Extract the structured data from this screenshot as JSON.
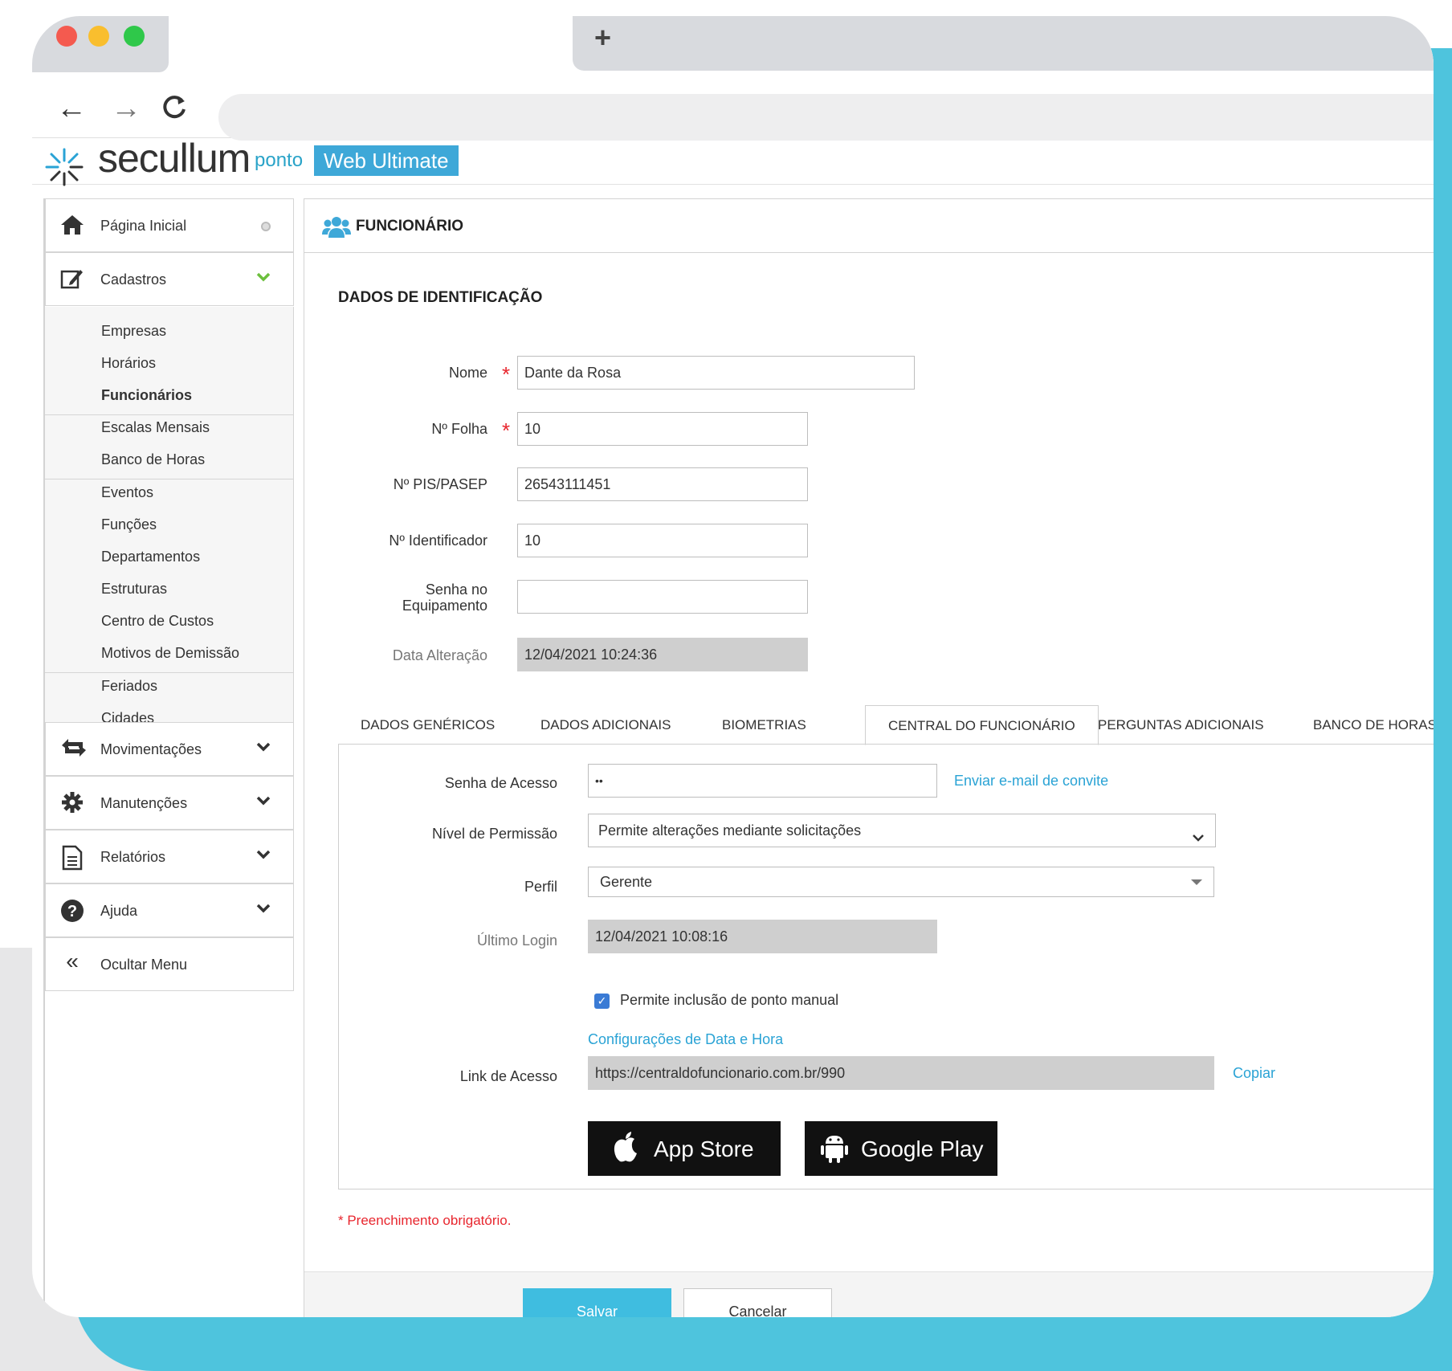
{
  "browser": {
    "new_tab_symbol": "+",
    "back_symbol": "←",
    "forward_symbol": "→",
    "reload_symbol": "C",
    "address": ""
  },
  "app": {
    "brand": "secullum",
    "product": "ponto",
    "edition": "Web Ultimate"
  },
  "sidebar": {
    "home": "Página Inicial",
    "cadastros": "Cadastros",
    "submenu": [
      "Empresas",
      "Horários",
      "Funcionários",
      "Escalas Mensais",
      "Banco de Horas",
      "Eventos",
      "Funções",
      "Departamentos",
      "Estruturas",
      "Centro de Custos",
      "Motivos de Demissão",
      "Feriados",
      "Cidades"
    ],
    "active_submenu": "Funcionários",
    "movimentacoes": "Movimentações",
    "manutencoes": "Manutenções",
    "relatorios": "Relatórios",
    "ajuda": "Ajuda",
    "ocultar": "Ocultar Menu",
    "chevron": "❯",
    "collapse_symbol": "«"
  },
  "panel": {
    "title": "FUNCIONÁRIO",
    "section_title": "DADOS DE IDENTIFICAÇÃO"
  },
  "fields": {
    "nome_label": "Nome",
    "nome_value": "Dante da Rosa",
    "folha_label": "Nº Folha",
    "folha_value": "10",
    "pis_label": "Nº PIS/PASEP",
    "pis_value": "26543111451",
    "identificador_label": "Nº Identificador",
    "identificador_value": "10",
    "senha_equip_label_1": "Senha no",
    "senha_equip_label_2": "Equipamento",
    "senha_equip_value": "",
    "data_alteracao_label": "Data Alteração",
    "data_alteracao_value": "12/04/2021 10:24:36",
    "required_mark": "*"
  },
  "tabs": [
    "DADOS GENÉRICOS",
    "DADOS ADICIONAIS",
    "BIOMETRIAS",
    "CENTRAL DO FUNCIONÁRIO",
    "PERGUNTAS ADICIONAIS",
    "BANCO DE HORAS"
  ],
  "active_tab": "CENTRAL DO FUNCIONÁRIO",
  "central": {
    "senha_label": "Senha de Acesso",
    "senha_value": "••",
    "invite_link": "Enviar e-mail de convite",
    "nivel_label": "Nível de Permissão",
    "nivel_value": "Permite alterações mediante solicitações",
    "perfil_label": "Perfil",
    "perfil_value": "Gerente",
    "ultimo_login_label": "Último Login",
    "ultimo_login_value": "12/04/2021 10:08:16",
    "checkbox_label": "Permite inclusão de ponto manual",
    "checkbox_checked": true,
    "config_link": "Configurações de Data e Hora",
    "link_label": "Link de Acesso",
    "link_value": "https://centraldofuncionario.com.br/990",
    "copy_link": "Copiar",
    "app_store": "App Store",
    "google_play": "Google Play"
  },
  "footer": {
    "required_note": "* Preenchimento obrigatório.",
    "save": "Salvar",
    "cancel": "Cancelar"
  },
  "colors": {
    "accent": "#3fbde0",
    "link": "#2aa3d5",
    "required": "#e8262e",
    "background_teal": "#4ec4dd"
  },
  "icons": {
    "home": "home-icon",
    "cadastros": "edit-icon",
    "movimentacoes": "transfer-icon",
    "manutencoes": "gear-icon",
    "relatorios": "document-icon",
    "ajuda": "help-icon",
    "panel": "users-icon"
  }
}
